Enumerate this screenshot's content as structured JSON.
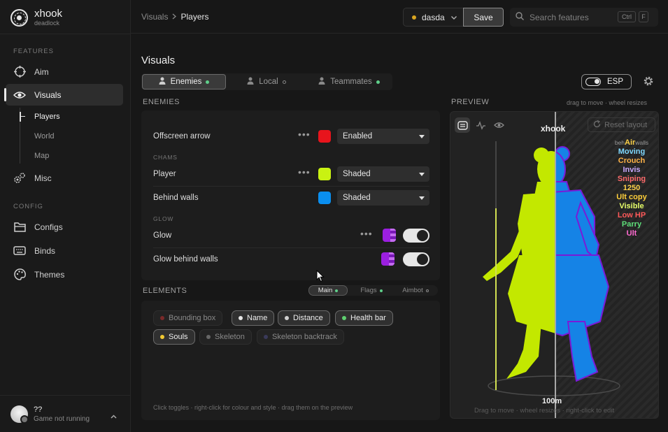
{
  "app": {
    "name": "xhook",
    "sub": "deadlock"
  },
  "sidebar": {
    "features_label": "FEATURES",
    "config_label": "CONFIG",
    "items": [
      {
        "label": "Aim",
        "icon": "crosshair-icon"
      },
      {
        "label": "Visuals",
        "icon": "eye-icon"
      },
      {
        "label": "Misc",
        "icon": "gears-icon"
      },
      {
        "label": "Configs",
        "icon": "folder-icon"
      },
      {
        "label": "Binds",
        "icon": "keyboard-icon"
      },
      {
        "label": "Themes",
        "icon": "palette-icon"
      }
    ],
    "subitems": [
      "Players",
      "World",
      "Map"
    ]
  },
  "user": {
    "name": "??",
    "status": "Game not running"
  },
  "topbar": {
    "crumbs": [
      "Visuals",
      "Players"
    ],
    "profile": "dasda",
    "save_label": "Save",
    "search_placeholder": "Search features",
    "kbd": [
      "Ctrl",
      "F"
    ]
  },
  "main": {
    "title": "Visuals",
    "tabs": [
      {
        "label": "Enemies",
        "dot": "#5fcf8a"
      },
      {
        "label": "Local",
        "dot": "#888888"
      },
      {
        "label": "Teammates",
        "dot": "#5fcf8a"
      }
    ],
    "esp_label": "ESP"
  },
  "enemies": {
    "header": "ENEMIES",
    "offscreen": {
      "label": "Offscreen arrow",
      "color": "#e8141c",
      "value": "Enabled"
    },
    "chams_label": "CHAMS",
    "player": {
      "label": "Player",
      "color": "#c9f212",
      "value": "Shaded"
    },
    "behind": {
      "label": "Behind walls",
      "color": "#0a8ff0",
      "value": "Shaded"
    },
    "glow_label": "GLOW",
    "glow": {
      "label": "Glow"
    },
    "glow_behind": {
      "label": "Glow behind walls"
    }
  },
  "elements": {
    "header": "ELEMENTS",
    "subtabs": [
      {
        "label": "Main",
        "dot": "#5fcf8a"
      },
      {
        "label": "Flags",
        "dot": "#5fcf8a"
      },
      {
        "label": "Aimbot",
        "dot": "#888888"
      }
    ],
    "chips": [
      {
        "label": "Bounding box",
        "dot": "#7a2a2a",
        "on": false
      },
      {
        "label": "Name",
        "dot": "#e6e6e6",
        "on": true
      },
      {
        "label": "Distance",
        "dot": "#cfcfcf",
        "on": true
      },
      {
        "label": "Health bar",
        "dot": "#5fd070",
        "on": true
      },
      {
        "label": "Souls",
        "dot": "#f0c832",
        "on": true
      },
      {
        "label": "Skeleton",
        "dot": "#666666",
        "on": false
      },
      {
        "label": "Skeleton backtrack",
        "dot": "#3a3a5a",
        "on": false
      }
    ],
    "hint": "Click toggles · right-click for colour and style · drag them on the preview"
  },
  "preview": {
    "header": "PREVIEW",
    "hint": "drag to move · wheel resizes",
    "name": "xhook",
    "reset_label": "Reset layout",
    "distance": "100m",
    "health_fraction": 0.73,
    "footer": "Drag to move · wheel resizes · right-click to edit",
    "flags_prefix": "beh",
    "flags_air": "Air",
    "flags_suffix": "walls",
    "flags": [
      {
        "label": "Moving",
        "color": "#7fd8ff"
      },
      {
        "label": "Crouch",
        "color": "#ffb347"
      },
      {
        "label": "Invis",
        "color": "#c8a8ff"
      },
      {
        "label": "Sniping",
        "color": "#ff6b6b"
      },
      {
        "label": "1250",
        "color": "#ffd24a"
      },
      {
        "label": "Ult copy",
        "color": "#ffcf3a"
      },
      {
        "label": "Visible",
        "color": "#e8ff6a"
      },
      {
        "label": "Low HP",
        "color": "#ff5a5a"
      },
      {
        "label": "Parry",
        "color": "#5fe07a"
      },
      {
        "label": "Ult",
        "color": "#ff6ad0"
      }
    ]
  }
}
